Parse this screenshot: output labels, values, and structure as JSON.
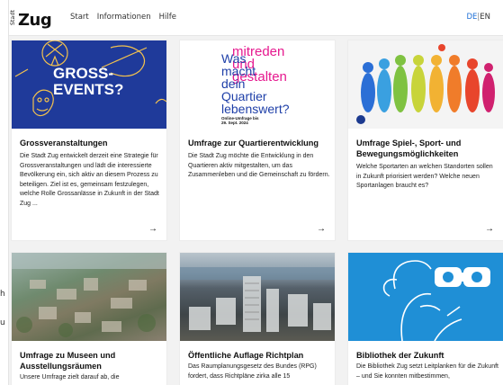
{
  "header": {
    "logo_small": "Stadt",
    "logo_main": "Zug",
    "nav": [
      "Start",
      "Informationen",
      "Hilfe"
    ],
    "lang_de": "DE",
    "lang_sep": "|",
    "lang_en": "EN"
  },
  "left_fragments": [
    "h",
    "u"
  ],
  "cards": [
    {
      "image_text": "GROSS-\nEVENTS?",
      "title": "Grossveranstaltungen",
      "text": "Die Stadt Zug entwickelt derzeit eine Strategie für Grossveranstaltungen und lädt die interessierte Bevölkerung ein, sich aktiv an diesem Prozess zu beteiligen. Ziel ist es, gemeinsam festzulegen, welche Rolle Grossanlässe in Zukunft in der Stadt Zug ...",
      "arrow": "→"
    },
    {
      "image_lines": [
        "mitreden",
        "und",
        "gestalten",
        "Was",
        "macht",
        "dein",
        "Quartier",
        "lebenswert?"
      ],
      "image_small": "Online-Umfrage bis\n29. Sept. 2024",
      "title": "Umfrage zur Quartierentwicklung",
      "text": "Die Stadt Zug möchte die Entwicklung in den Quartieren aktiv mitgestalten, um das Zusammenleben und die Gemeinschaft zu fördern.",
      "arrow": "→"
    },
    {
      "title": "Umfrage Spiel-, Sport- und Bewegungsmöglichkeiten",
      "text": "Welche Sportarten an welchen Standorten sollen in Zukunft priorisiert werden? Welche neuen Sportanlagen braucht es?",
      "arrow": "→"
    },
    {
      "title": "Umfrage zu Museen und Ausstellungsräumen",
      "text": "Unsere Umfrage zielt darauf ab, die"
    },
    {
      "title": "Öffentliche Auflage Richtplan",
      "text": "Das Raumplanungsgesetz des Bundes (RPG) fordert, dass Richtpläne zirka alle 15"
    },
    {
      "title": "Bibliothek der Zukunft",
      "text": "Die Bibliothek Zug setzt Leitplanken für die Zukunft – und Sie konnten mitbestimmen,"
    }
  ],
  "colors": {
    "events_bg": "#1f3a9a",
    "quartier_magenta": "#e6198f",
    "quartier_blue": "#1e3fa8",
    "biblio_bg": "#1f8fd6",
    "lang_active": "#1d6fd6"
  }
}
